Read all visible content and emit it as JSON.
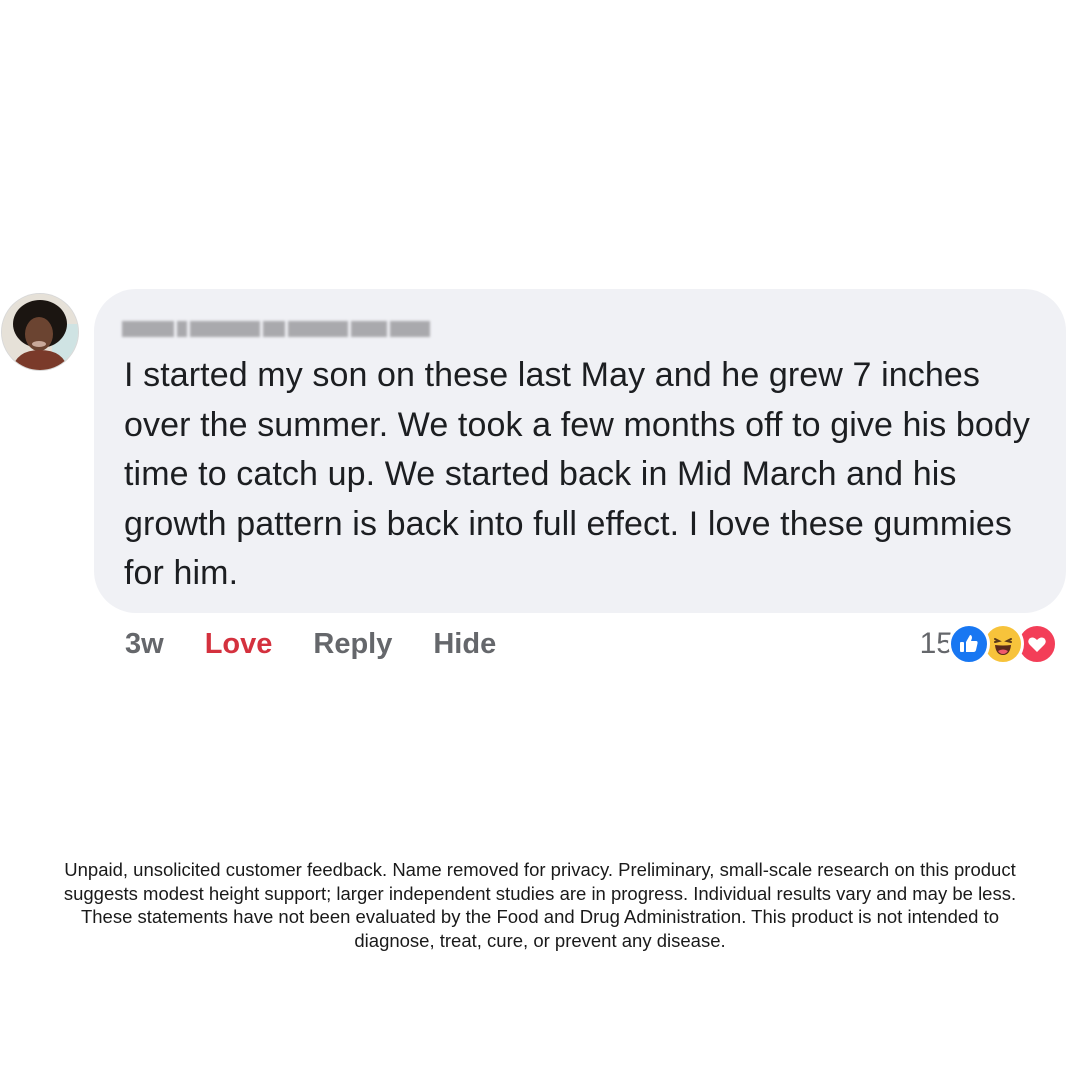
{
  "comment": {
    "author_name": "",
    "text": "I started my son on these last May and he grew 7 inches over the summer. We took a few months off to give his body time to catch up. We started back in Mid March and his growth pattern is back into full effect. I love these gummies for him.",
    "timestamp": "3w",
    "actions": {
      "love": "Love",
      "reply": "Reply",
      "hide": "Hide"
    },
    "reaction_count": "15",
    "reactions": [
      "thumbs-up-icon",
      "laughing-face-icon",
      "heart-icon"
    ]
  },
  "colors": {
    "bubble": "#f0f1f5",
    "love_active": "#d4313e",
    "action_gray": "#65676b",
    "like": "#1877f2",
    "haha": "#f7c33b",
    "heart": "#f33e58"
  },
  "disclaimer": "Unpaid, unsolicited customer feedback. Name removed for privacy. Preliminary, small-scale research on this product suggests modest height support; larger independent studies are in progress. Individual results vary and may be less. These statements have not been evaluated by the Food and Drug Administration. This product is not intended to diagnose, treat, cure, or prevent any disease."
}
